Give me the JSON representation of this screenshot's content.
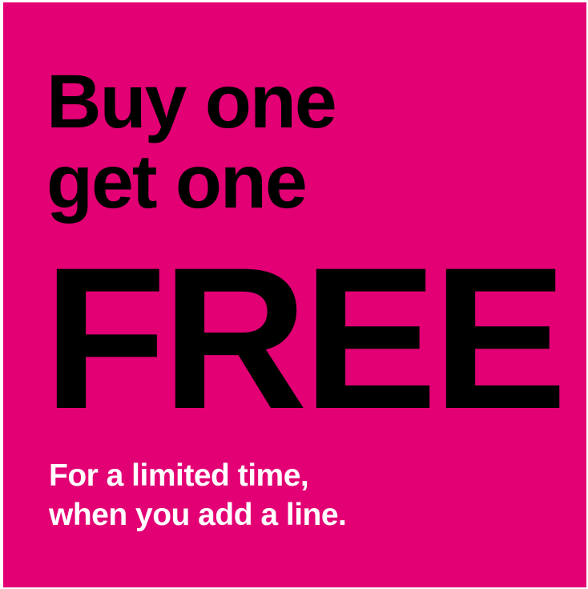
{
  "ad": {
    "headline_line1": "Buy one",
    "headline_line2": "get one",
    "headline_emphasis": "FREE",
    "subline_line1": "For a limited time,",
    "subline_line2": "when you add a line."
  },
  "colors": {
    "background": "#e20074",
    "headline_text": "#000000",
    "subline_text": "#ffffff"
  }
}
